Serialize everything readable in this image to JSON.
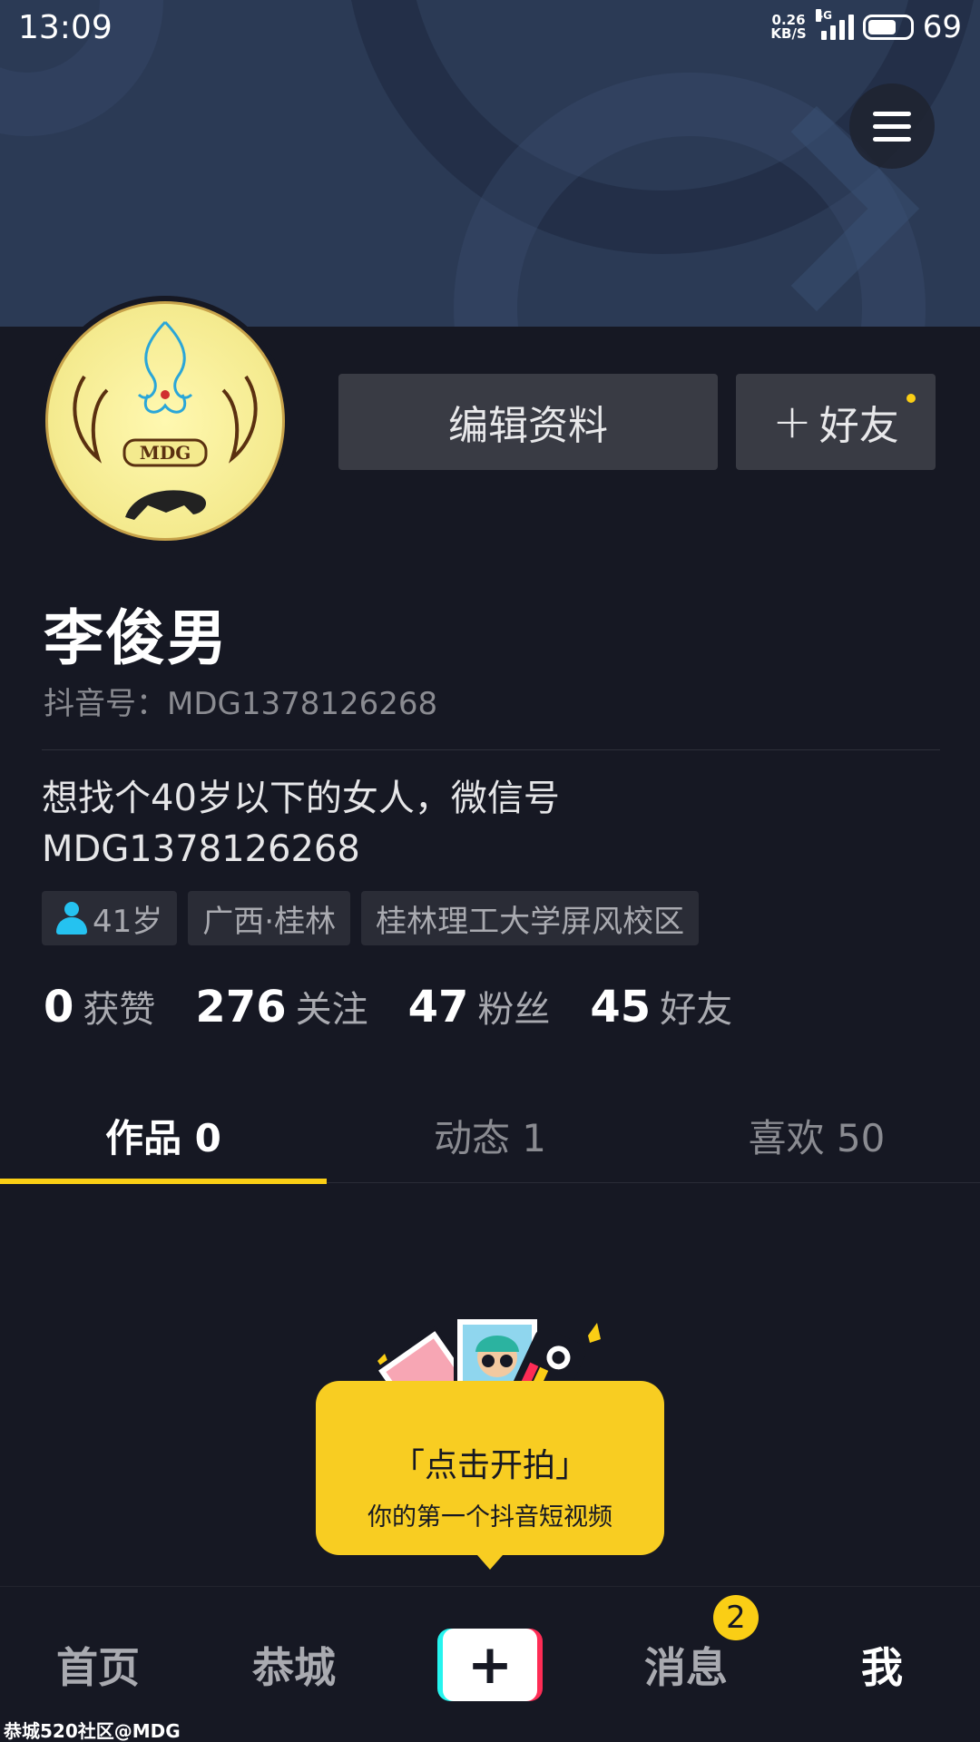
{
  "status_bar": {
    "time": "13:09",
    "net_speed_value": "0.26",
    "net_speed_unit": "KB/S",
    "network_type": "4G",
    "battery_percent": "69",
    "battery_level": 0.69
  },
  "profile": {
    "display_name": "李俊男",
    "douyin_id_label": "抖音号：MDG1378126268",
    "avatar_text": "MDG",
    "bio_line1": "想找个40岁以下的女人，微信号",
    "bio_line2": "MDG1378126268",
    "edit_button": "编辑资料",
    "add_friend_icon": "+",
    "add_friend_label": "好友"
  },
  "tags": {
    "age": "41岁",
    "location": "广西·桂林",
    "school": "桂林理工大学屏风校区"
  },
  "stats": [
    {
      "num": "0",
      "label": "获赞"
    },
    {
      "num": "276",
      "label": "关注"
    },
    {
      "num": "47",
      "label": "粉丝"
    },
    {
      "num": "45",
      "label": "好友"
    }
  ],
  "tabs": [
    {
      "label": "作品 0"
    },
    {
      "label": "动态 1"
    },
    {
      "label": "喜欢 50"
    }
  ],
  "shoot_prompt": {
    "title": "「点击开拍」",
    "subtitle": "你的第一个抖音短视频"
  },
  "bottom_nav": {
    "home": "首页",
    "city": "恭城",
    "plus": "+",
    "messages": "消息",
    "messages_badge": "2",
    "me": "我"
  },
  "watermark": "恭城520社区@MDG",
  "colors": {
    "background": "#161823",
    "accent": "#face15",
    "button_bg": "#393b44",
    "tag_icon": "#25c2f0"
  }
}
